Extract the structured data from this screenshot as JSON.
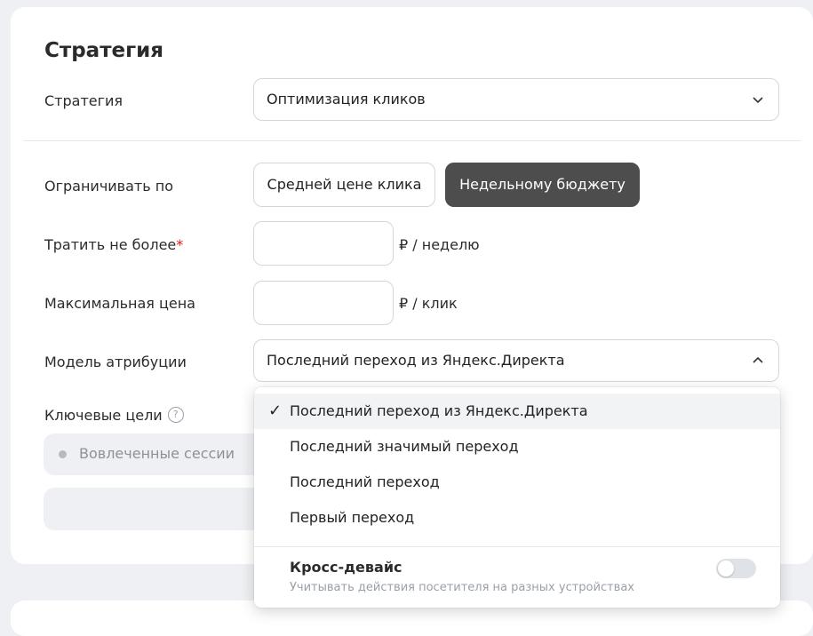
{
  "section": {
    "title": "Стратегия"
  },
  "strategy": {
    "label": "Стратегия",
    "value": "Оптимизация кликов"
  },
  "limit": {
    "label": "Ограничивать по",
    "options": [
      "Средней цене клика",
      "Недельному бюджету"
    ],
    "selected": "Недельному бюджету"
  },
  "spend": {
    "label": "Тратить не более",
    "required_mark": "*",
    "value": "",
    "unit": "₽ / неделю"
  },
  "max_price": {
    "label": "Максимальная цена",
    "value": "",
    "unit": "₽ / клик"
  },
  "attribution": {
    "label": "Модель атрибуции",
    "value": "Последний переход из Яндекс.Директа",
    "options": [
      "Последний переход из Яндекс.Директа",
      "Последний значимый переход",
      "Последний переход",
      "Первый переход"
    ],
    "selected_index": 0,
    "check_glyph": "✓",
    "cross_device": {
      "title": "Кросс-девайс",
      "subtitle": "Учитывать действия посетителя на разных устройствах",
      "enabled": false
    }
  },
  "goals": {
    "label": "Ключевые цели",
    "help_glyph": "?",
    "items": [
      "Вовлеченные сессии"
    ]
  },
  "colors": {
    "active_segment": "#4d4d4d",
    "required": "#e11111",
    "page_bg": "#eef0f4"
  }
}
